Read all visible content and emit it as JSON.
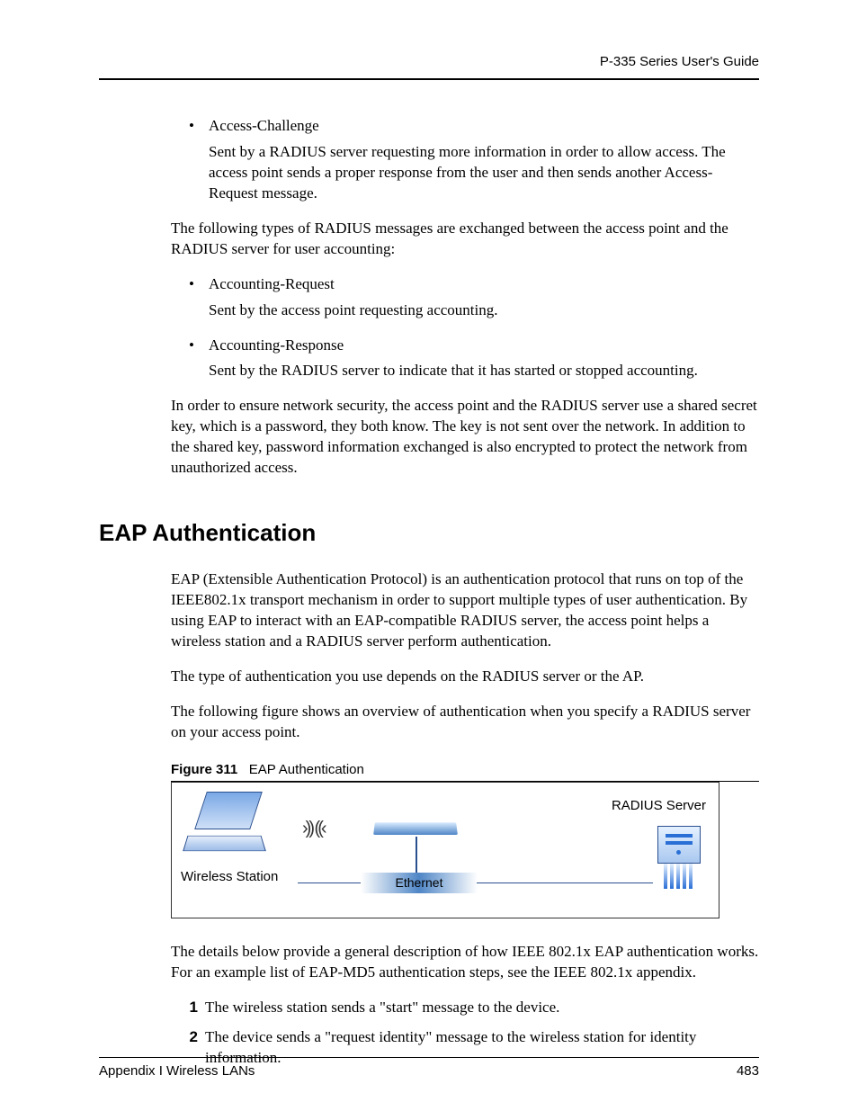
{
  "header": {
    "guide": "P-335 Series User's Guide"
  },
  "bullets1": {
    "item": "Access-Challenge",
    "desc": "Sent by a RADIUS server requesting more information in order to allow access. The access point sends a proper response from the user and then sends another Access-Request message."
  },
  "para1": "The following types of RADIUS messages are exchanged between the access point and the RADIUS server for user accounting:",
  "bullets2": [
    {
      "item": "Accounting-Request",
      "desc": "Sent by the access point requesting accounting."
    },
    {
      "item": "Accounting-Response",
      "desc": "Sent by the RADIUS server to indicate that it has started or stopped accounting."
    }
  ],
  "para2": "In order to ensure network security, the access point and the RADIUS server use a shared secret key, which is a password, they both know. The key is not sent over the network. In addition to the shared key, password information exchanged is also encrypted to protect the network from unauthorized access.",
  "section": "EAP Authentication",
  "eap_p1": "EAP (Extensible Authentication Protocol) is an authentication protocol that runs on top of the IEEE802.1x transport mechanism in order to support multiple types of user authentication. By using EAP to interact with an EAP-compatible RADIUS server, the access point helps a wireless station and a RADIUS server perform authentication.",
  "eap_p2": "The type of authentication you use depends on the RADIUS server or the AP.",
  "eap_p3": "The following figure shows an overview of authentication when you specify a RADIUS server on your access point.",
  "figcap": {
    "label": "Figure 311",
    "title": "EAP Authentication"
  },
  "figure": {
    "wireless_station": "Wireless Station",
    "ethernet": "Ethernet",
    "radius": "RADIUS Server"
  },
  "eap_p4": "The details below provide a general description of how IEEE 802.1x EAP authentication works. For an example list of EAP-MD5 authentication steps, see the IEEE 802.1x appendix.",
  "steps": [
    "The wireless station sends a \"start\" message to the device.",
    "The device sends a \"request identity\" message to the wireless station for identity information."
  ],
  "footer": {
    "appendix": "Appendix I Wireless LANs",
    "page": "483"
  }
}
